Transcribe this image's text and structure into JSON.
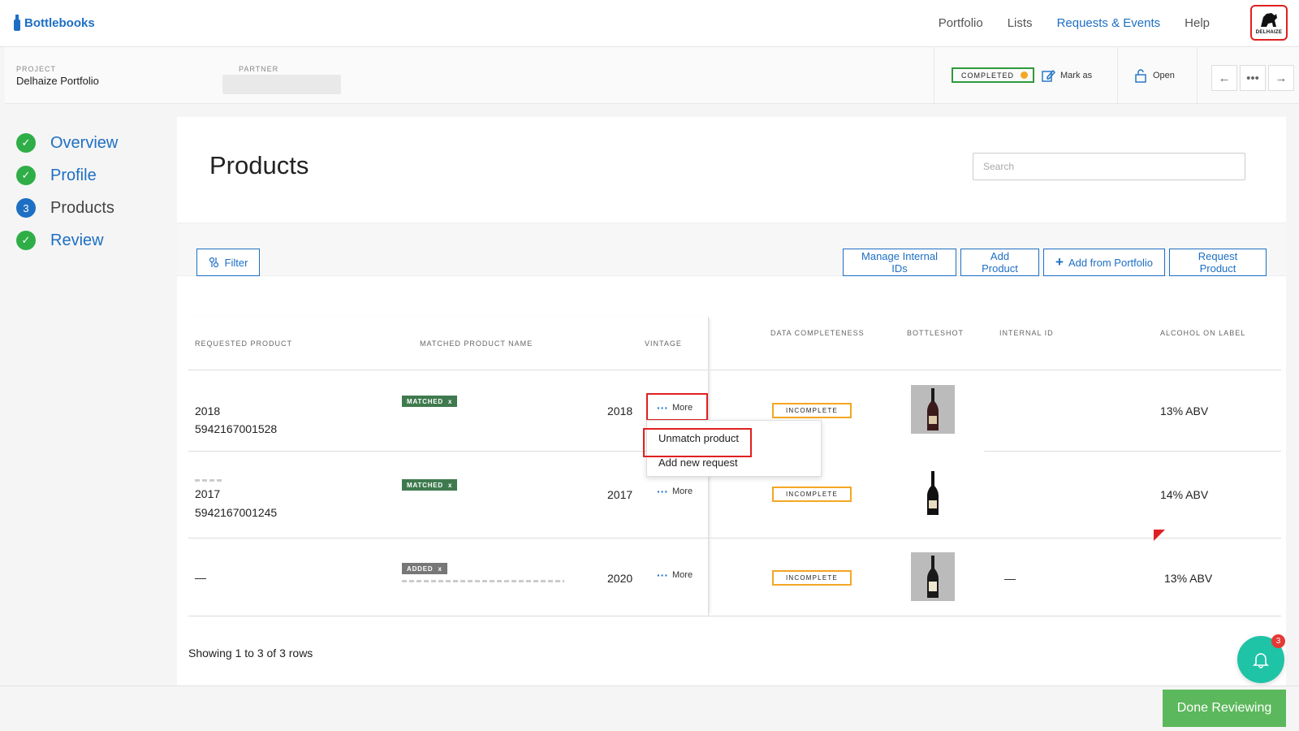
{
  "app": {
    "brand": "Bottlebooks",
    "nav": [
      "Portfolio",
      "Lists",
      "Requests & Events",
      "Help"
    ],
    "logo_text": "DELHAIZE",
    "accent": "#1d6fc4"
  },
  "project": {
    "project_label": "PROJECT",
    "project_value": "Delhaize Portfolio",
    "partner_label": "PARTNER",
    "status": "COMPLETED",
    "mark_as": "Mark as",
    "open": "Open"
  },
  "steps": [
    {
      "num": "✓",
      "label": "Overview",
      "state": "done"
    },
    {
      "num": "✓",
      "label": "Profile",
      "state": "done"
    },
    {
      "num": "3",
      "label": "Products",
      "state": "current"
    },
    {
      "num": "✓",
      "label": "Review",
      "state": "done"
    }
  ],
  "main": {
    "title": "Products",
    "search_placeholder": "Search",
    "filter": "Filter",
    "buttons": [
      "Manage Internal IDs",
      "Add Product",
      "Add from Portfolio",
      "Request Product"
    ]
  },
  "table": {
    "headers": [
      "REQUESTED PRODUCT",
      "MATCHED PRODUCT NAME",
      "VINTAGE",
      "DATA COMPLETENESS",
      "BOTTLESHOT",
      "INTERNAL ID",
      "ALCOHOL ON LABEL"
    ],
    "rows": [
      {
        "req_line1": "2018",
        "req_line2": "5942167001528",
        "tag": "MATCHED",
        "vintage": "2018",
        "more": "More",
        "completeness": "INCOMPLETE",
        "internal_id": "",
        "alcohol": "13% ABV"
      },
      {
        "req_line1": "2017",
        "req_line2": "5942167001245",
        "tag": "MATCHED",
        "vintage": "2017",
        "more": "More",
        "completeness": "INCOMPLETE",
        "internal_id": "",
        "alcohol": "14% ABV"
      },
      {
        "req_line1": "—",
        "req_line2": "",
        "tag": "ADDED",
        "vintage": "2020",
        "more": "More",
        "completeness": "INCOMPLETE",
        "internal_id": "—",
        "alcohol": "13% ABV"
      }
    ],
    "tag_close": "x",
    "menu": [
      "Unmatch product",
      "Add new request"
    ],
    "footer": "Showing 1 to 3 of 3 rows"
  },
  "footer": {
    "done": "Done Reviewing"
  },
  "notifications": {
    "count": "3"
  }
}
